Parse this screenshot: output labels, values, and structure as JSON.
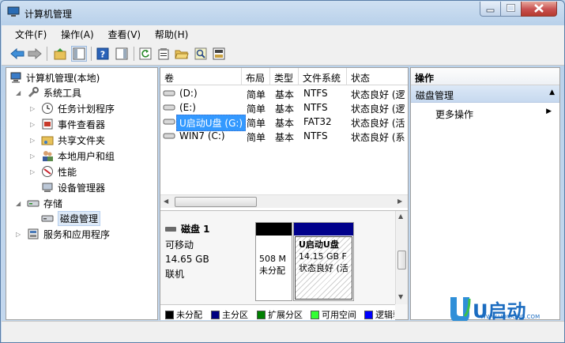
{
  "window": {
    "title": "计算机管理"
  },
  "menu": [
    "文件(F)",
    "操作(A)",
    "查看(V)",
    "帮助(H)"
  ],
  "tree": {
    "root": "计算机管理(本地)",
    "system_tools": "系统工具",
    "task_scheduler": "任务计划程序",
    "event_viewer": "事件查看器",
    "shared_folders": "共享文件夹",
    "local_users": "本地用户和组",
    "performance": "性能",
    "device_manager": "设备管理器",
    "storage": "存储",
    "disk_management": "磁盘管理",
    "services": "服务和应用程序"
  },
  "volume_table": {
    "headers": [
      "卷",
      "布局",
      "类型",
      "文件系统",
      "状态"
    ],
    "rows": [
      {
        "vol": "(D:)",
        "layout": "简单",
        "type": "基本",
        "fs": "NTFS",
        "status": "状态良好 (逻"
      },
      {
        "vol": "(E:)",
        "layout": "简单",
        "type": "基本",
        "fs": "NTFS",
        "status": "状态良好 (逻"
      },
      {
        "vol": "U启动U盘 (G:)",
        "layout": "简单",
        "type": "基本",
        "fs": "FAT32",
        "status": "状态良好 (活"
      },
      {
        "vol": "WIN7 (C:)",
        "layout": "简单",
        "type": "基本",
        "fs": "NTFS",
        "status": "状态良好 (系"
      }
    ]
  },
  "disk": {
    "name": "磁盘 1",
    "kind": "可移动",
    "size": "14.65 GB",
    "state": "联机",
    "partitions": [
      {
        "size": "508 M",
        "label": "未分配"
      },
      {
        "name": "U启动U盘",
        "size": "14.15 GB F",
        "status": "状态良好 (活"
      }
    ]
  },
  "legend": [
    {
      "label": "未分配",
      "color": "#000000"
    },
    {
      "label": "主分区",
      "color": "#000080"
    },
    {
      "label": "扩展分区",
      "color": "#008000"
    },
    {
      "label": "可用空间",
      "color": "#33ff33"
    },
    {
      "label": "逻辑驱",
      "color": "#0000ff"
    }
  ],
  "actions": {
    "header": "操作",
    "section": "磁盘管理",
    "more": "更多操作"
  },
  "watermark": {
    "brand": "U启动",
    "url": "WWW.UQIDONG.COM"
  }
}
